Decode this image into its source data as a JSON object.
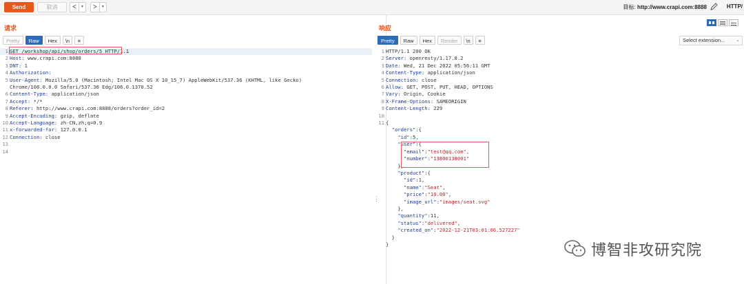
{
  "toolbar": {
    "send_label": "Send",
    "cancel_label": "取消",
    "back_glyph": "<",
    "forward_glyph": ">",
    "dropdown_glyph": "▾",
    "target_label": "目标:",
    "target_value": "http://www.crapi.com:8888",
    "protocol": "HTTP/"
  },
  "request": {
    "title": "请求",
    "tabs": [
      {
        "label": "Pretty",
        "state": "disabled"
      },
      {
        "label": "Raw",
        "state": "active"
      },
      {
        "label": "Hex",
        "state": "normal"
      },
      {
        "label": "\\n",
        "state": "normal"
      },
      {
        "label": "≡",
        "state": "normal"
      }
    ],
    "lines": [
      {
        "n": "1",
        "key": "",
        "rest": "GET /workshop/api/shop/orders/5 HTTP/1.1"
      },
      {
        "n": "2",
        "key": "Host:",
        "rest": " www.crapi.com:8888"
      },
      {
        "n": "3",
        "key": "DNT:",
        "rest": " 1"
      },
      {
        "n": "4",
        "key": "Authorization:",
        "rest": ""
      },
      {
        "n": "5",
        "key": "User-Agent:",
        "rest": " Mozilla/5.0 (Macintosh; Intel Mac OS X 10_15_7) AppleWebKit/537.36 (KHTML, like Gecko)"
      },
      {
        "n": "",
        "key": "",
        "rest": "Chrome/106.0.0.0 Safari/537.36 Edg/106.0.1370.52"
      },
      {
        "n": "6",
        "key": "Content-Type:",
        "rest": " application/json"
      },
      {
        "n": "7",
        "key": "Accept:",
        "rest": " */*"
      },
      {
        "n": "8",
        "key": "Referer:",
        "rest": " http://www.crapi.com:8888/orders?order_id=2"
      },
      {
        "n": "9",
        "key": "Accept-Encoding:",
        "rest": " gzip, deflate"
      },
      {
        "n": "10",
        "key": "Accept-Language:",
        "rest": " zh-CN,zh;q=0.9"
      },
      {
        "n": "11",
        "key": "x-forwarded-for:",
        "rest": " 127.0.0.1"
      },
      {
        "n": "12",
        "key": "Connection:",
        "rest": " close"
      },
      {
        "n": "13",
        "key": "",
        "rest": ""
      },
      {
        "n": "14",
        "key": "",
        "rest": ""
      }
    ]
  },
  "response": {
    "title": "响应",
    "tabs": [
      {
        "label": "Pretty",
        "state": "active"
      },
      {
        "label": "Raw",
        "state": "normal"
      },
      {
        "label": "Hex",
        "state": "normal"
      },
      {
        "label": "Render",
        "state": "disabled"
      },
      {
        "label": "\\n",
        "state": "normal"
      },
      {
        "label": "≡",
        "state": "normal"
      }
    ],
    "select_extension": "Select extension...",
    "headers": [
      {
        "n": "1",
        "key": "",
        "rest": "HTTP/1.1 200 OK"
      },
      {
        "n": "2",
        "key": "Server:",
        "rest": " openresty/1.17.8.2"
      },
      {
        "n": "3",
        "key": "Date:",
        "rest": " Wed, 21 Dec 2022 05:56:11 GMT"
      },
      {
        "n": "4",
        "key": "Content-Type:",
        "rest": " application/json"
      },
      {
        "n": "5",
        "key": "Connection:",
        "rest": " close"
      },
      {
        "n": "6",
        "key": "Allow:",
        "rest": " GET, POST, PUT, HEAD, OPTIONS"
      },
      {
        "n": "7",
        "key": "Vary:",
        "rest": " Origin, Cookie"
      },
      {
        "n": "8",
        "key": "X-Frame-Options:",
        "rest": " SAMEORIGIN"
      },
      {
        "n": "9",
        "key": "Content-Length:",
        "rest": " 229"
      },
      {
        "n": "10",
        "key": "",
        "rest": ""
      }
    ],
    "json_lines": [
      {
        "n": "11",
        "text": "{"
      },
      {
        "n": "",
        "text": "  \"orders\":{"
      },
      {
        "n": "",
        "text": "    \"id\":5,"
      },
      {
        "n": "",
        "text": "    \"user\":{"
      },
      {
        "n": "",
        "text": "      \"email\":\"test@qq.com\","
      },
      {
        "n": "",
        "text": "      \"number\":\"13800138001\""
      },
      {
        "n": "",
        "text": "    },"
      },
      {
        "n": "",
        "text": "    \"product\":{"
      },
      {
        "n": "",
        "text": "      \"id\":1,"
      },
      {
        "n": "",
        "text": "      \"name\":\"Seat\","
      },
      {
        "n": "",
        "text": "      \"price\":\"10.00\","
      },
      {
        "n": "",
        "text": "      \"image_url\":\"images/seat.svg\""
      },
      {
        "n": "",
        "text": "    },"
      },
      {
        "n": "",
        "text": "    \"quantity\":11,"
      },
      {
        "n": "",
        "text": "    \"status\":\"delivered\","
      },
      {
        "n": "",
        "text": "    \"created_on\":\"2022-12-21T03:01:06.527227\""
      },
      {
        "n": "",
        "text": "  }"
      },
      {
        "n": "",
        "text": "}"
      }
    ]
  },
  "watermark": {
    "text": "博智非攻研究院",
    "icon": "wechat-icon"
  },
  "colors": {
    "accent": "#e8571b",
    "active_tab": "#2d6ab8",
    "header_key": "#1f3a93",
    "string_value": "#b3262a",
    "highlight_box": "#e55b5b"
  }
}
